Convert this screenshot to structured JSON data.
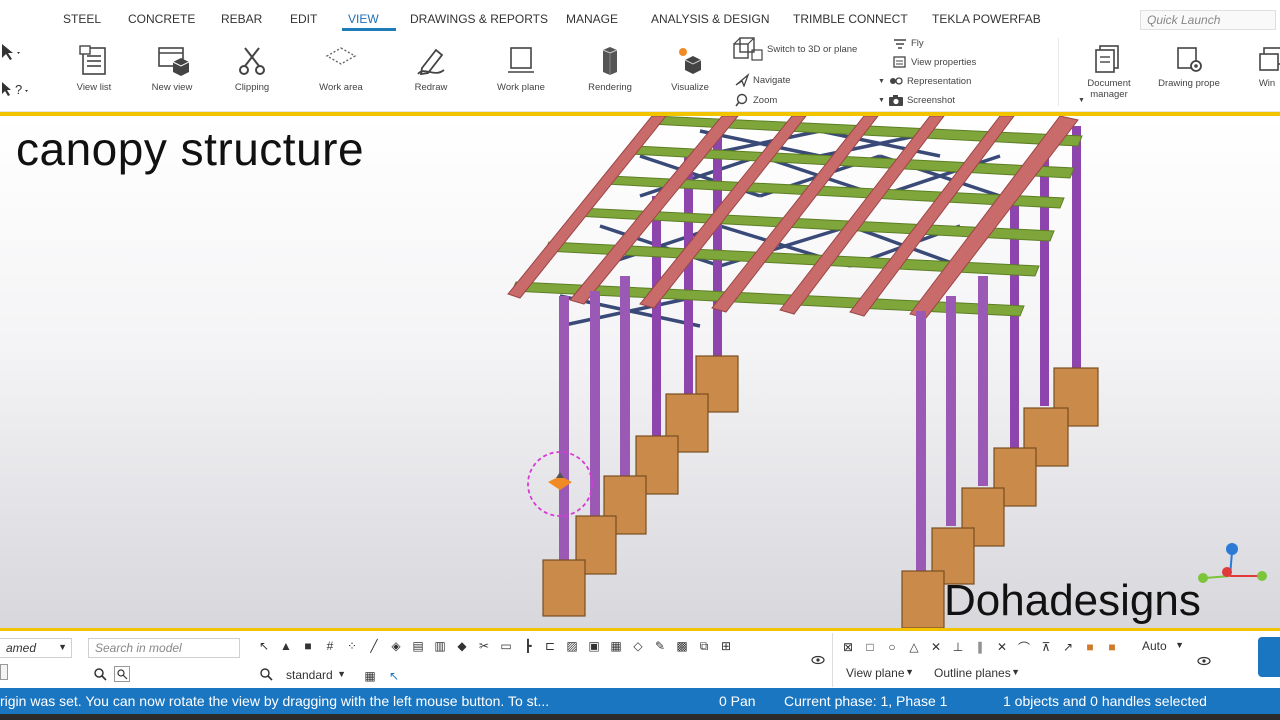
{
  "menu": {
    "items": [
      "STEEL",
      "CONCRETE",
      "REBAR",
      "EDIT",
      "VIEW",
      "DRAWINGS & REPORTS",
      "MANAGE",
      "ANALYSIS & DESIGN",
      "TRIMBLE CONNECT",
      "TEKLA POWERFAB"
    ],
    "active": "VIEW",
    "quick_launch_placeholder": "Quick Launch"
  },
  "ribbon": {
    "view_list": "View list",
    "new_view": "New view",
    "clipping": "Clipping",
    "work_area": "Work area",
    "redraw": "Redraw",
    "work_plane": "Work plane",
    "rendering": "Rendering",
    "visualize": "Visualize",
    "switch_3d": "Switch to 3D or plane",
    "navigate": "Navigate",
    "zoom": "Zoom",
    "fly": "Fly",
    "view_properties": "View properties",
    "representation": "Representation",
    "screenshot": "Screenshot",
    "document_manager": "Document manager",
    "drawing_properties": "Drawing prope",
    "windows": "Win"
  },
  "viewport": {
    "title": "canopy structure",
    "watermark": "Dohadesigns"
  },
  "bottom_toolbar": {
    "named_combo": "amed",
    "search_placeholder": "Search in model",
    "standard_combo": "standard",
    "auto_combo": "Auto",
    "view_plane": "View plane",
    "outline_planes": "Outline planes"
  },
  "statusbar": {
    "message": "rigin was set. You can now rotate the view by dragging with the left mouse button. To st...",
    "pan": "0 Pan",
    "phase": "Current phase: 1, Phase 1",
    "selection": "1 objects and 0 handles selected"
  },
  "colors": {
    "accent_yellow": "#f2c400",
    "status_blue": "#1b76c2",
    "rafter_red": "#c96b6b",
    "purlin_green": "#7fa63a",
    "column_purple": "#9b59b6",
    "footing_brown": "#c98a4a",
    "bracing_blue": "#3a4a78"
  }
}
